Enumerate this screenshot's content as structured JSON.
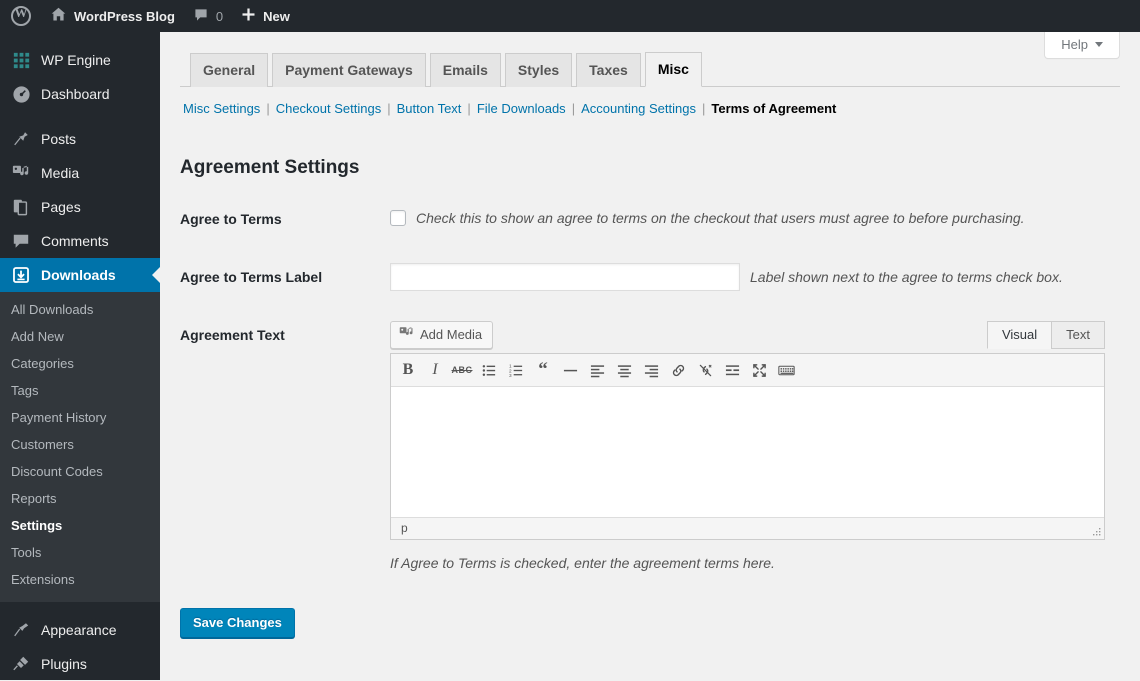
{
  "adminbar": {
    "logo_icon": "wordpress-logo-icon",
    "site_icon": "home-icon",
    "site_name": "WordPress Blog",
    "comments_icon": "comment-bubble-icon",
    "comments_count": "0",
    "new_icon": "plus-icon",
    "new_label": "New"
  },
  "sidebar": {
    "top_items": [
      {
        "label": "WP Engine",
        "icon": "grid-squares-icon",
        "current": false
      },
      {
        "label": "Dashboard",
        "icon": "dashboard-gauge-icon",
        "current": false
      },
      {
        "label": "Posts",
        "icon": "pushpin-icon",
        "current": false
      },
      {
        "label": "Media",
        "icon": "media-music-photo-icon",
        "current": false
      },
      {
        "label": "Pages",
        "icon": "pages-icon",
        "current": false
      },
      {
        "label": "Comments",
        "icon": "comment-bubble-icon",
        "current": false
      },
      {
        "label": "Downloads",
        "icon": "download-box-icon",
        "current": true
      }
    ],
    "submenu": [
      {
        "label": "All Downloads",
        "current": false
      },
      {
        "label": "Add New",
        "current": false
      },
      {
        "label": "Categories",
        "current": false
      },
      {
        "label": "Tags",
        "current": false
      },
      {
        "label": "Payment History",
        "current": false
      },
      {
        "label": "Customers",
        "current": false
      },
      {
        "label": "Discount Codes",
        "current": false
      },
      {
        "label": "Reports",
        "current": false
      },
      {
        "label": "Settings",
        "current": true
      },
      {
        "label": "Tools",
        "current": false
      },
      {
        "label": "Extensions",
        "current": false
      }
    ],
    "bottom_items": [
      {
        "label": "Appearance",
        "icon": "paintbrush-icon"
      },
      {
        "label": "Plugins",
        "icon": "plug-icon"
      }
    ]
  },
  "screen_meta": {
    "help_label": "Help",
    "help_caret_icon": "chevron-down-icon"
  },
  "tabs": [
    {
      "label": "General",
      "active": false
    },
    {
      "label": "Payment Gateways",
      "active": false
    },
    {
      "label": "Emails",
      "active": false
    },
    {
      "label": "Styles",
      "active": false
    },
    {
      "label": "Taxes",
      "active": false
    },
    {
      "label": "Misc",
      "active": true
    }
  ],
  "subnav": [
    {
      "label": "Misc Settings",
      "current": false
    },
    {
      "label": "Checkout Settings",
      "current": false
    },
    {
      "label": "Button Text",
      "current": false
    },
    {
      "label": "File Downloads",
      "current": false
    },
    {
      "label": "Accounting Settings",
      "current": false
    },
    {
      "label": "Terms of Agreement",
      "current": true
    }
  ],
  "subnav_separator": "|",
  "section": {
    "title": "Agreement Settings"
  },
  "fields": {
    "agree_to_terms": {
      "label": "Agree to Terms",
      "checked": false,
      "description": "Check this to show an agree to terms on the checkout that users must agree to before purchasing."
    },
    "agree_to_terms_label": {
      "label": "Agree to Terms Label",
      "value": "",
      "placeholder": "",
      "description": "Label shown next to the agree to terms check box."
    },
    "agreement_text": {
      "label": "Agreement Text",
      "add_media_label": "Add Media",
      "add_media_icon": "media-add-icon",
      "editor_tabs": [
        {
          "label": "Visual",
          "active": true
        },
        {
          "label": "Text",
          "active": false
        }
      ],
      "toolbar": [
        {
          "name": "bold-icon",
          "glyph": "B"
        },
        {
          "name": "italic-icon",
          "glyph": "I"
        },
        {
          "name": "strikethrough-icon",
          "glyph": "ABC"
        },
        {
          "name": "bulleted-list-icon",
          "glyph": ""
        },
        {
          "name": "numbered-list-icon",
          "glyph": ""
        },
        {
          "name": "blockquote-icon",
          "glyph": "“"
        },
        {
          "name": "horizontal-rule-icon",
          "glyph": ""
        },
        {
          "name": "align-left-icon",
          "glyph": ""
        },
        {
          "name": "align-center-icon",
          "glyph": ""
        },
        {
          "name": "align-right-icon",
          "glyph": ""
        },
        {
          "name": "insert-link-icon",
          "glyph": ""
        },
        {
          "name": "remove-link-icon",
          "glyph": ""
        },
        {
          "name": "insert-read-more-icon",
          "glyph": ""
        },
        {
          "name": "distraction-free-icon",
          "glyph": ""
        },
        {
          "name": "keyboard-shortcuts-icon",
          "glyph": ""
        }
      ],
      "content": "",
      "statusbar_path": "p",
      "resize_handle_icon": "resize-grip-icon",
      "description": "If Agree to Terms is checked, enter the agreement terms here."
    }
  },
  "submit": {
    "save_label": "Save Changes"
  },
  "colors": {
    "admin_bar_bg": "#23282d",
    "sidebar_bg": "#23282d",
    "submenu_bg": "#32373c",
    "current_menu_bg": "#0073aa",
    "link_blue": "#0073aa",
    "primary_button_bg": "#0085ba",
    "page_bg": "#f1f1f1",
    "wp_engine_teal": "#2a7b7b"
  }
}
